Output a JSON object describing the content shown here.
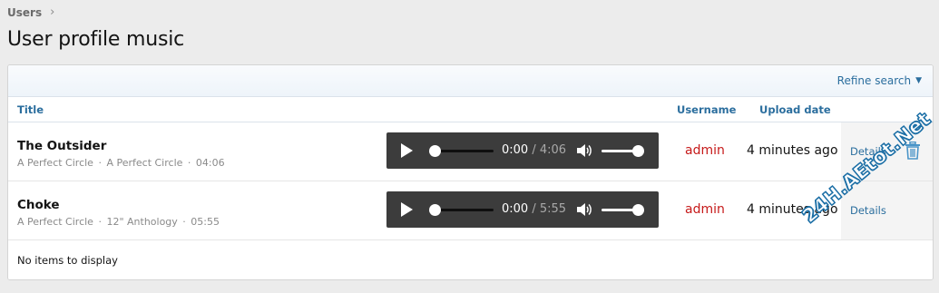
{
  "breadcrumb": {
    "label": "Users"
  },
  "page": {
    "title": "User profile music"
  },
  "filter": {
    "refine_label": "Refine search"
  },
  "columns": {
    "title": "Title",
    "username": "Username",
    "upload_date": "Upload date"
  },
  "rows": [
    {
      "title": "The Outsider",
      "artist": "A Perfect Circle",
      "album": "A Perfect Circle",
      "length": "04:06",
      "player": {
        "current": "0:00",
        "duration": "/ 4:06",
        "progress": 0,
        "volume": 1
      },
      "username": "admin",
      "upload_date": "4 minutes ago",
      "details_label": "Details"
    },
    {
      "title": "Choke",
      "artist": "A Perfect Circle",
      "album": "12\" Anthology",
      "length": "05:55",
      "player": {
        "current": "0:00",
        "duration": "/ 5:55",
        "progress": 0,
        "volume": 1
      },
      "username": "admin",
      "upload_date": "4 minutes ago",
      "details_label": "Details"
    }
  ],
  "footer": {
    "empty_text": "No items to display"
  },
  "watermark": {
    "text": "24H.AEtot.Net"
  },
  "colors": {
    "link": "#2b6e9e",
    "username": "#c61a1a",
    "player_bg": "#3c3c3c",
    "trash": "#4b95c8"
  }
}
